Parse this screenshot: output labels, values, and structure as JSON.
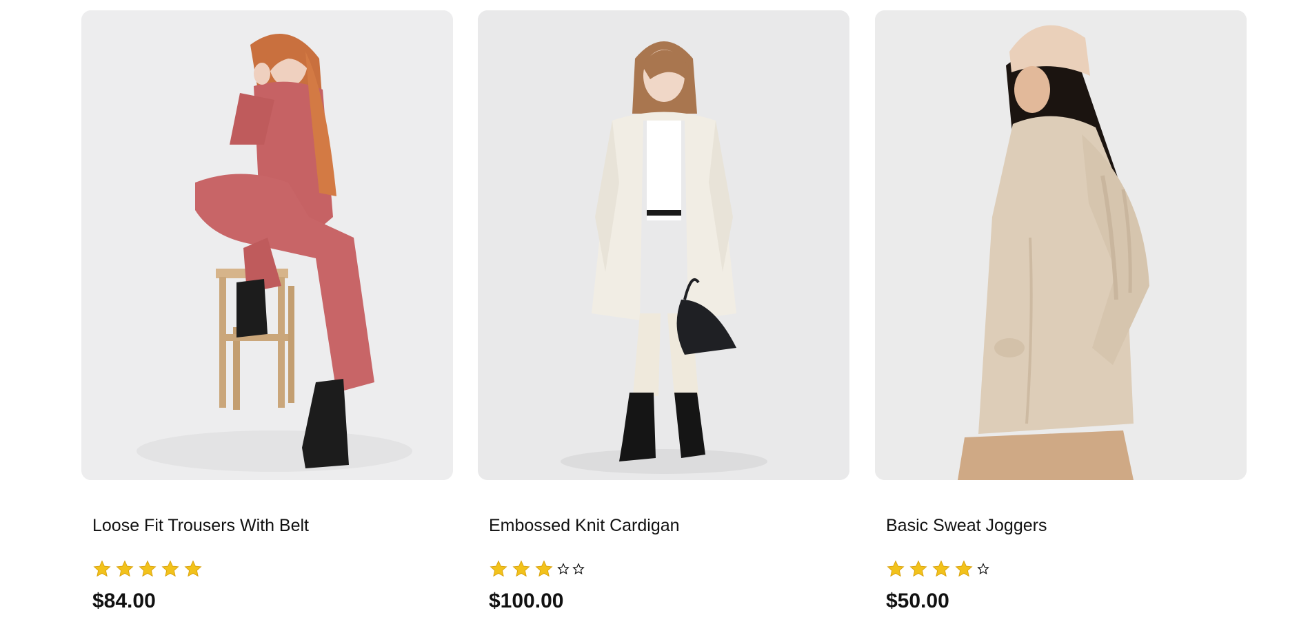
{
  "products": [
    {
      "name": "Loose Fit Trousers With Belt",
      "price": "$84.00",
      "rating": 5,
      "max_rating": 5,
      "image": "woman-in-rose-trouser-suit-sitting-on-stool"
    },
    {
      "name": "Embossed Knit Cardigan",
      "price": "$100.00",
      "rating": 3,
      "max_rating": 5,
      "image": "woman-in-cream-coat-with-black-handbag"
    },
    {
      "name": "Basic Sweat Joggers",
      "price": "$50.00",
      "rating": 4,
      "max_rating": 5,
      "image": "woman-in-beige-cable-knit-cardigan-and-beanie"
    }
  ],
  "colors": {
    "star_filled": "#f2c21b",
    "star_outline": "#111111",
    "photo_bg": "#ededee",
    "text": "#111111"
  }
}
